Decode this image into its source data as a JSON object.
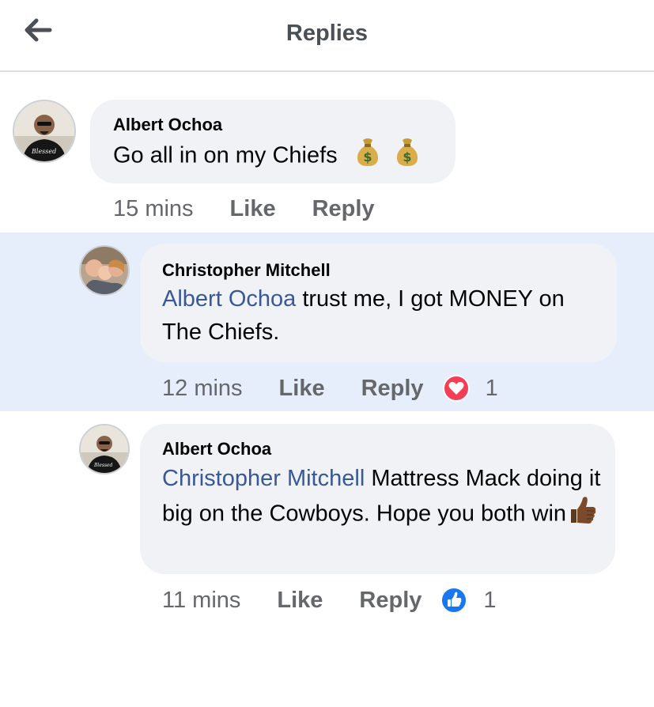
{
  "header": {
    "title": "Replies"
  },
  "comments": [
    {
      "author": "Albert Ochoa",
      "mention": "",
      "text": "Go all in on my Chiefs",
      "emoji": [
        "money-bag",
        "money-bag"
      ],
      "time": "15 mins",
      "like_label": "Like",
      "reply_label": "Reply",
      "reaction": null
    },
    {
      "author": "Christopher Mitchell",
      "mention": "Albert Ochoa",
      "text": " trust me, I got MONEY on The Chiefs.",
      "time": "12 mins",
      "like_label": "Like",
      "reply_label": "Reply",
      "reaction": {
        "type": "love",
        "count": "1"
      }
    },
    {
      "author": "Albert Ochoa",
      "mention": "Christopher Mitchell",
      "text": " Mattress Mack doing it big on the Cowboys. Hope you both win",
      "emoji": [
        "thumbs-up"
      ],
      "time": "11 mins",
      "like_label": "Like",
      "reply_label": "Reply",
      "reaction": {
        "type": "like",
        "count": "1"
      }
    }
  ],
  "colors": {
    "mention": "#385898",
    "bubble": "#f0f2f5",
    "highlight": "#e7eefb",
    "love": "#f33e58",
    "like": "#1877f2"
  }
}
